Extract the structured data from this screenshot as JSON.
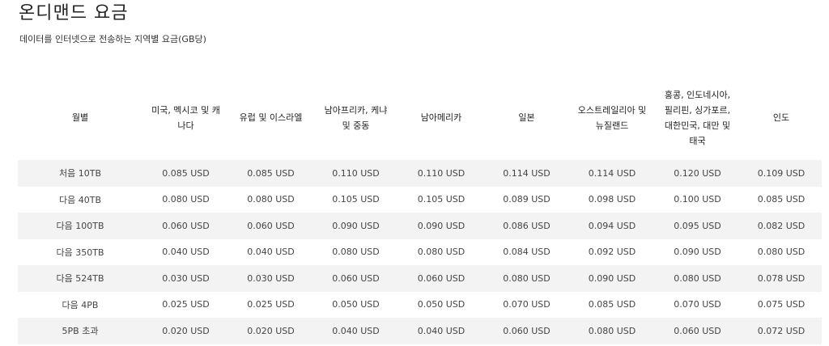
{
  "page": {
    "title": "온디맨드 요금",
    "subtitle": "데이터를 인터넷으로 전송하는 지역별 요금(GB당)"
  },
  "table": {
    "headers": [
      "월별",
      "미국, 멕시코 및 캐나다",
      "유럽 및 이스라엘",
      "남아프리카, 케냐 및 중동",
      "남아메리카",
      "일본",
      "오스트레일리아 및 뉴질랜드",
      "홍콩, 인도네시아, 필리핀, 싱가포르, 대한민국, 대만 및 태국",
      "인도"
    ],
    "rows": [
      [
        "처음 10TB",
        "0.085 USD",
        "0.085 USD",
        "0.110 USD",
        "0.110 USD",
        "0.114 USD",
        "0.114 USD",
        "0.120 USD",
        "0.109 USD"
      ],
      [
        "다음 40TB",
        "0.080 USD",
        "0.080 USD",
        "0.105 USD",
        "0.105 USD",
        "0.089 USD",
        "0.098 USD",
        "0.100 USD",
        "0.085 USD"
      ],
      [
        "다음 100TB",
        "0.060 USD",
        "0.060 USD",
        "0.090 USD",
        "0.090 USD",
        "0.086 USD",
        "0.094 USD",
        "0.095 USD",
        "0.082 USD"
      ],
      [
        "다음 350TB",
        "0.040 USD",
        "0.040 USD",
        "0.080 USD",
        "0.080 USD",
        "0.084 USD",
        "0.092 USD",
        "0.090 USD",
        "0.080 USD"
      ],
      [
        "다음 524TB",
        "0.030 USD",
        "0.030 USD",
        "0.060 USD",
        "0.060 USD",
        "0.080 USD",
        "0.090 USD",
        "0.080 USD",
        "0.078 USD"
      ],
      [
        "다음 4PB",
        "0.025 USD",
        "0.025 USD",
        "0.050 USD",
        "0.050 USD",
        "0.070 USD",
        "0.085 USD",
        "0.070 USD",
        "0.075 USD"
      ],
      [
        "5PB 초과",
        "0.020 USD",
        "0.020 USD",
        "0.040 USD",
        "0.040 USD",
        "0.060 USD",
        "0.080 USD",
        "0.060 USD",
        "0.072 USD"
      ]
    ]
  }
}
